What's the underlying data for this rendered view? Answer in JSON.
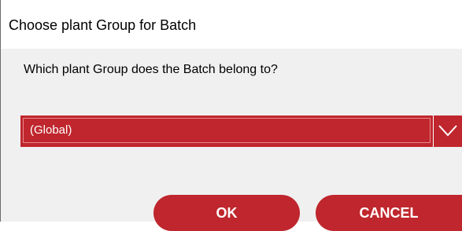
{
  "dialog": {
    "title": "Choose plant Group for Batch",
    "question": "Which plant Group does the Batch belong to?",
    "group_select": {
      "value": "(Global)"
    },
    "buttons": {
      "ok_label": "OK",
      "cancel_label": "CANCEL"
    }
  },
  "colors": {
    "accent": "#c0262d",
    "content_background": "#f0f0f0",
    "title_background": "#ffffff"
  },
  "icons": {
    "dropdown": "chevron-down-icon"
  }
}
